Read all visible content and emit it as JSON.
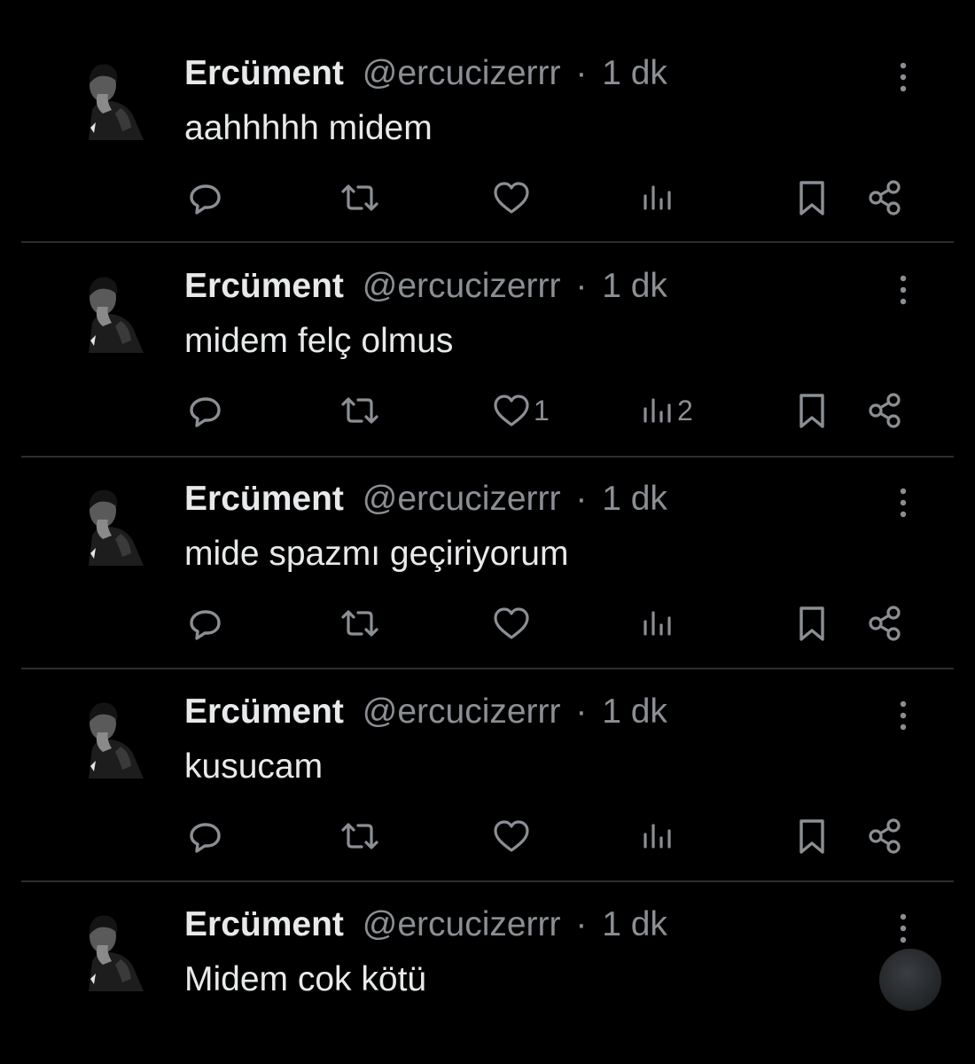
{
  "tweets": [
    {
      "name": "Ercüment",
      "handle": "@ercucizerrr",
      "separator": "·",
      "time": "1 dk",
      "text": "aahhhhh midem",
      "likes": "",
      "views": ""
    },
    {
      "name": "Ercüment",
      "handle": "@ercucizerrr",
      "separator": "·",
      "time": "1 dk",
      "text": "midem felç olmus",
      "likes": "1",
      "views": "2"
    },
    {
      "name": "Ercüment",
      "handle": "@ercucizerrr",
      "separator": "·",
      "time": "1 dk",
      "text": "mide spazmı geçiriyorum",
      "likes": "",
      "views": ""
    },
    {
      "name": "Ercüment",
      "handle": "@ercucizerrr",
      "separator": "·",
      "time": "1 dk",
      "text": "kusucam",
      "likes": "",
      "views": ""
    },
    {
      "name": "Ercüment",
      "handle": "@ercucizerrr",
      "separator": "·",
      "time": "1 dk",
      "text": "Midem cok kötü",
      "likes": "",
      "views": ""
    }
  ],
  "icons": {
    "reply": "reply-icon",
    "retweet": "retweet-icon",
    "like": "heart-icon",
    "views": "views-icon",
    "bookmark": "bookmark-icon",
    "share": "share-icon",
    "more": "more-options-icon"
  },
  "colors": {
    "background": "#000000",
    "text_primary": "#e7e9ea",
    "text_secondary": "#8b8f94",
    "divider": "#2a2d31"
  }
}
